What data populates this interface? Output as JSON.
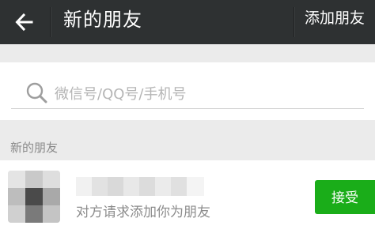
{
  "header": {
    "title": "新的朋友",
    "action_label": "添加朋友",
    "back_icon": "arrow-left-icon"
  },
  "search": {
    "placeholder": "微信号/QQ号/手机号",
    "icon": "search-icon"
  },
  "section": {
    "label": "新的朋友"
  },
  "requests": [
    {
      "message": "对方请求添加你为朋友",
      "accept_label": "接受"
    }
  ],
  "colors": {
    "header_bg": "#2e3132",
    "page_bg": "#ebebeb",
    "accept_green": "#1aad19",
    "placeholder": "#b5b5b5"
  }
}
